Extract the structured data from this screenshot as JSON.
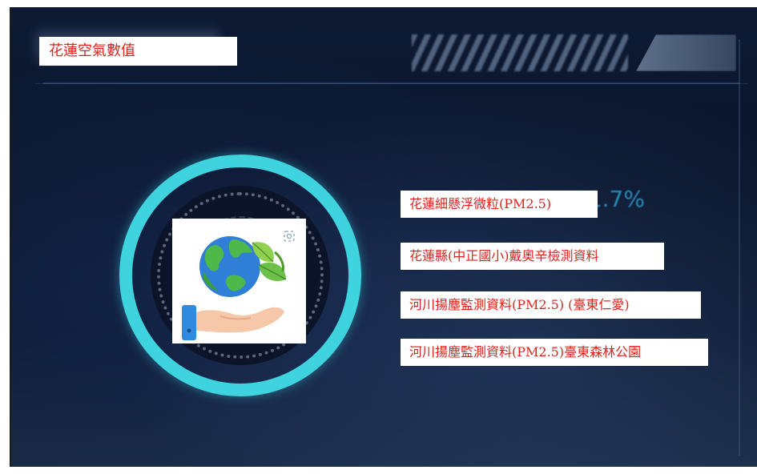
{
  "title": "花蓮空氣數值",
  "links": [
    {
      "label": "花蓮細懸浮微粒(PM2.5)"
    },
    {
      "label": "花蓮縣(中正國小)戴奧辛檢測資料"
    },
    {
      "label": "河川揚塵監測資料(PM2.5) (臺東仁愛)"
    },
    {
      "label": "河川揚塵監測資料(PM2.5)臺東森林公園"
    }
  ],
  "background_text": "11.7%",
  "icons": [
    "earth-in-hand-icon",
    "zoom-icon"
  ],
  "colors": {
    "link_text": "#e2211c",
    "ring": "#3fd3df",
    "background": "#0a152b"
  }
}
